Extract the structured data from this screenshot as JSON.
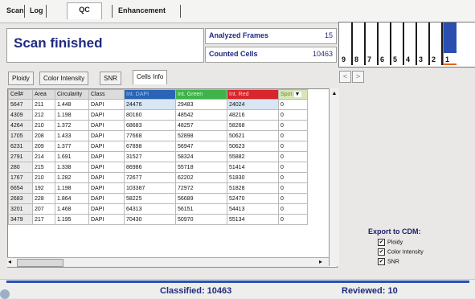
{
  "tabs": [
    "Scan",
    "Log",
    "QC",
    "Enhancement"
  ],
  "status": {
    "title": "Scan finished",
    "analyzed_label": "Analyzed Frames",
    "analyzed_value": "15",
    "counted_label": "Counted Cells",
    "counted_value": "10463"
  },
  "slots": [
    "9",
    "8",
    "7",
    "6",
    "5",
    "4",
    "3",
    "2",
    "1"
  ],
  "slot_colors": {
    "active": "#2b4fb0",
    "active_bottom": "#e0651e"
  },
  "subtabs": [
    "Ploidy",
    "Color Intensity",
    "SNR",
    "Cells Info"
  ],
  "grid": {
    "headers": [
      "Cell#",
      "Area",
      "Circularity",
      "Class",
      "Int. DAPI",
      "Int. Green",
      "Int. Red",
      "Spot #"
    ],
    "rows": [
      [
        "5647",
        "211",
        "1.448",
        "DAPI",
        "24476",
        "29483",
        "24024",
        "0"
      ],
      [
        "4309",
        "212",
        "1.198",
        "DAPI",
        "80160",
        "48542",
        "48216",
        "0"
      ],
      [
        "4264",
        "210",
        "1.372",
        "DAPI",
        "68683",
        "48257",
        "58268",
        "0"
      ],
      [
        "1705",
        "208",
        "1.433",
        "DAPI",
        "77668",
        "52898",
        "50621",
        "0"
      ],
      [
        "6231",
        "209",
        "1.377",
        "DAPI",
        "67898",
        "56947",
        "50623",
        "0"
      ],
      [
        "2791",
        "214",
        "1.691",
        "DAPI",
        "31527",
        "58324",
        "55882",
        "0"
      ],
      [
        "280",
        "215",
        "1.338",
        "DAPI",
        "86986",
        "55718",
        "51414",
        "0"
      ],
      [
        "1767",
        "210",
        "1.282",
        "DAPI",
        "72677",
        "62202",
        "51830",
        "0"
      ],
      [
        "6654",
        "192",
        "1.198",
        "DAPI",
        "103387",
        "72972",
        "51828",
        "0"
      ],
      [
        "2683",
        "228",
        "1.864",
        "DAPI",
        "58225",
        "56689",
        "52470",
        "0"
      ],
      [
        "3201",
        "207",
        "1.468",
        "DAPI",
        "64313",
        "56151",
        "54413",
        "0"
      ],
      [
        "3479",
        "217",
        "1.195",
        "DAPI",
        "70430",
        "50970",
        "55134",
        "0"
      ]
    ]
  },
  "export": {
    "title": "Export to CDM:",
    "options": [
      "Ploidy",
      "Color Intensity",
      "SNR"
    ],
    "check": "✔"
  },
  "bottom": {
    "classified": "Classified: 10463",
    "reviewed": "Reviewed: 10"
  },
  "icons": {
    "dropdown": "▼",
    "up": "▲",
    "down": "▼",
    "left": "◂",
    "right": "▸",
    "prev": "<",
    "next": ">"
  }
}
